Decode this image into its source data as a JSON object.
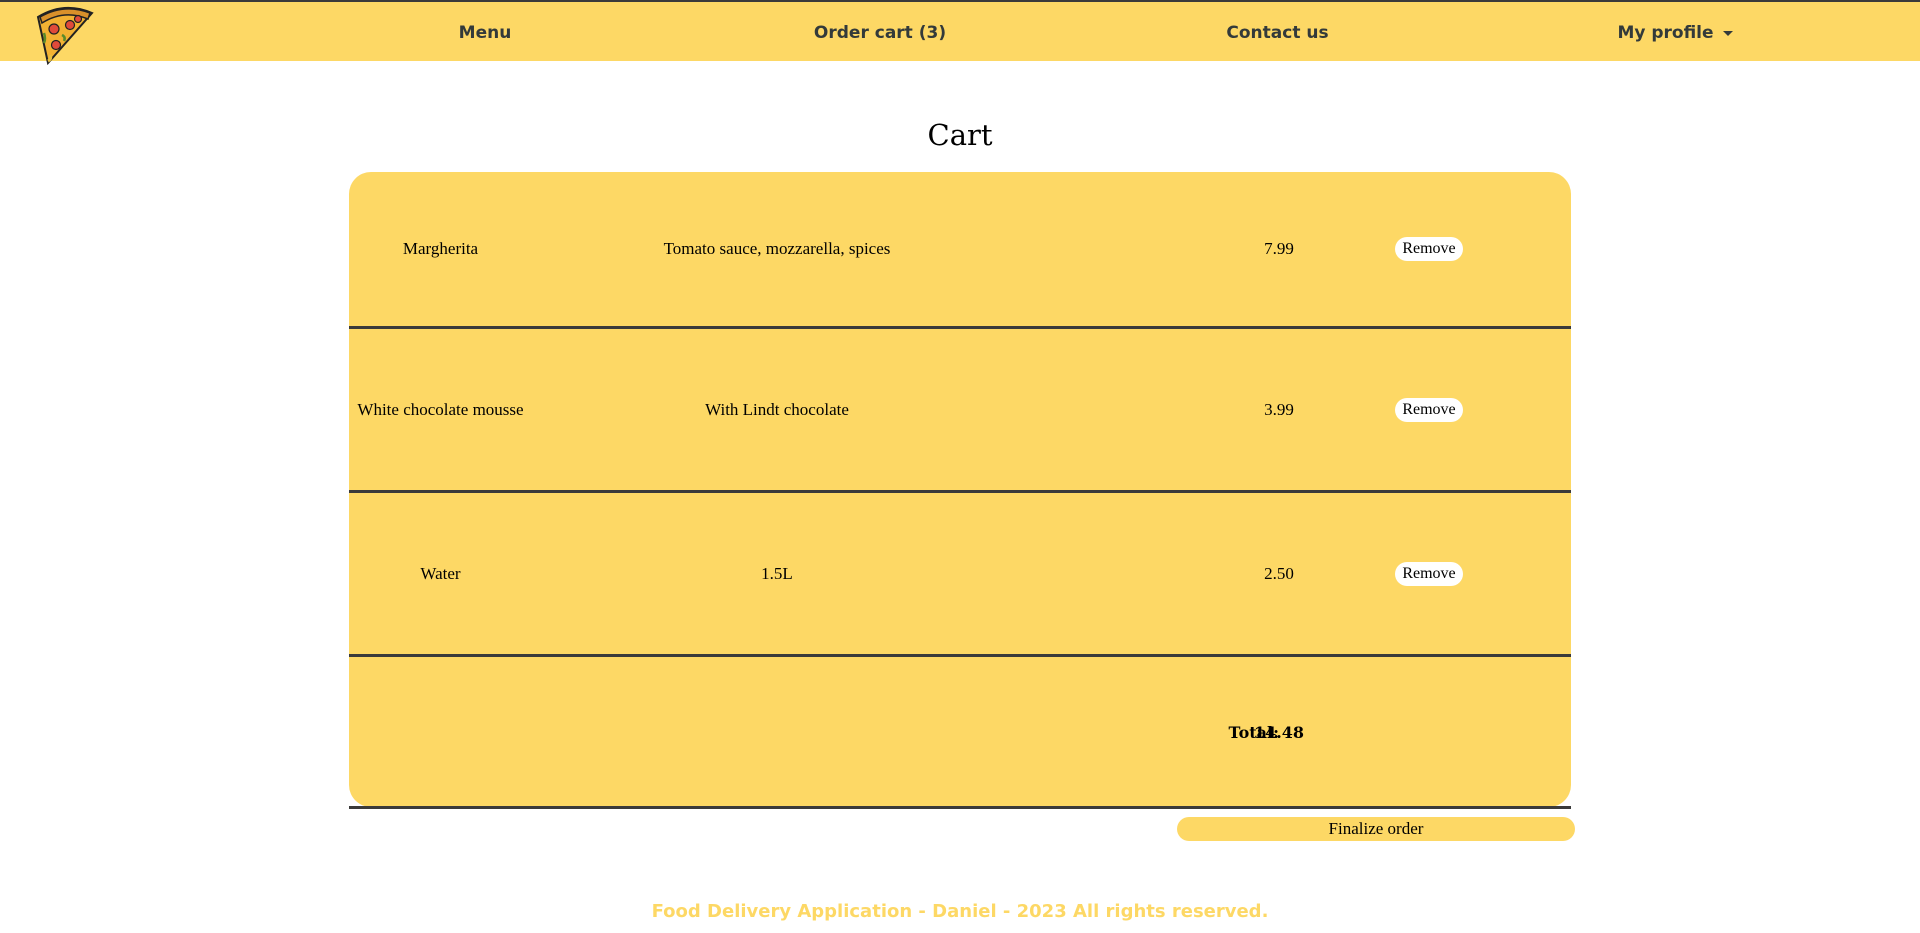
{
  "navbar": {
    "logo_icon": "pizza-slice-icon",
    "items": [
      {
        "label": "Menu"
      },
      {
        "label": "Order cart (3)"
      },
      {
        "label": "Contact us"
      },
      {
        "label": "My profile"
      }
    ]
  },
  "page": {
    "title": "Cart"
  },
  "cart": {
    "items": [
      {
        "name": "Margherita",
        "description": "Tomato sauce, mozzarella, spices",
        "price": "7.99",
        "action": "Remove"
      },
      {
        "name": "White chocolate mousse",
        "description": "With Lindt chocolate",
        "price": "3.99",
        "action": "Remove"
      },
      {
        "name": "Water",
        "description": "1.5L",
        "price": "2.50",
        "action": "Remove"
      }
    ],
    "total_label": "Total:",
    "total_value": "14.48",
    "finalize_label": "Finalize order"
  },
  "footer": {
    "text": "Food Delivery Application - Daniel - 2023 All rights reserved."
  },
  "colors": {
    "accent": "#fdd865",
    "dark": "#3a3a3a",
    "nav_text": "#333a3a"
  }
}
